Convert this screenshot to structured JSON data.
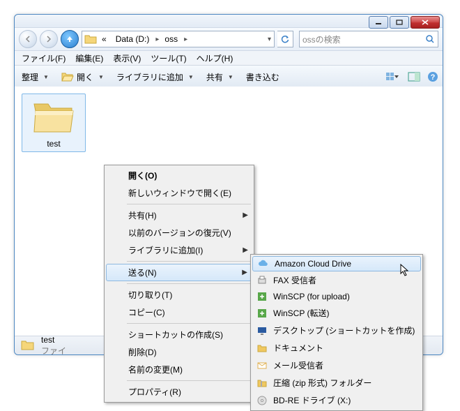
{
  "titlebar": {
    "minimize": "minimize",
    "maximize": "maximize",
    "close": "close"
  },
  "breadcrumb": {
    "prefix": "«",
    "drive": "Data (D:)",
    "folder": "oss"
  },
  "search": {
    "placeholder": "ossの検索"
  },
  "menubar": {
    "file": "ファイル(F)",
    "edit": "編集(E)",
    "view": "表示(V)",
    "tools": "ツール(T)",
    "help": "ヘルプ(H)"
  },
  "toolbar": {
    "organize": "整理",
    "open": "開く",
    "library": "ライブラリに追加",
    "share": "共有",
    "burn": "書き込む"
  },
  "content": {
    "folder_name": "test"
  },
  "statusbar": {
    "name": "test",
    "line2": "ファイ"
  },
  "context_menu": [
    {
      "label": "開く(O)",
      "bold": true
    },
    {
      "label": "新しいウィンドウで開く(E)"
    },
    {
      "sep": true
    },
    {
      "label": "共有(H)",
      "submenu": true
    },
    {
      "label": "以前のバージョンの復元(V)"
    },
    {
      "label": "ライブラリに追加(I)",
      "submenu": true
    },
    {
      "sep": true
    },
    {
      "label": "送る(N)",
      "submenu": true,
      "hl": true
    },
    {
      "sep": true
    },
    {
      "label": "切り取り(T)"
    },
    {
      "label": "コピー(C)"
    },
    {
      "sep": true
    },
    {
      "label": "ショートカットの作成(S)"
    },
    {
      "label": "削除(D)"
    },
    {
      "label": "名前の変更(M)"
    },
    {
      "sep": true
    },
    {
      "label": "プロパティ(R)"
    }
  ],
  "submenu": [
    {
      "label": "Amazon Cloud Drive",
      "icon": "cloud",
      "hl": true
    },
    {
      "label": "FAX 受信者",
      "icon": "fax"
    },
    {
      "label": "WinSCP (for upload)",
      "icon": "winscp"
    },
    {
      "label": "WinSCP (転送)",
      "icon": "winscp"
    },
    {
      "label": "デスクトップ (ショートカットを作成)",
      "icon": "desktop"
    },
    {
      "label": "ドキュメント",
      "icon": "folder"
    },
    {
      "label": "メール受信者",
      "icon": "mail"
    },
    {
      "label": "圧縮 (zip 形式) フォルダー",
      "icon": "zip"
    },
    {
      "label": "BD-RE ドライブ (X:)",
      "icon": "disc"
    }
  ]
}
